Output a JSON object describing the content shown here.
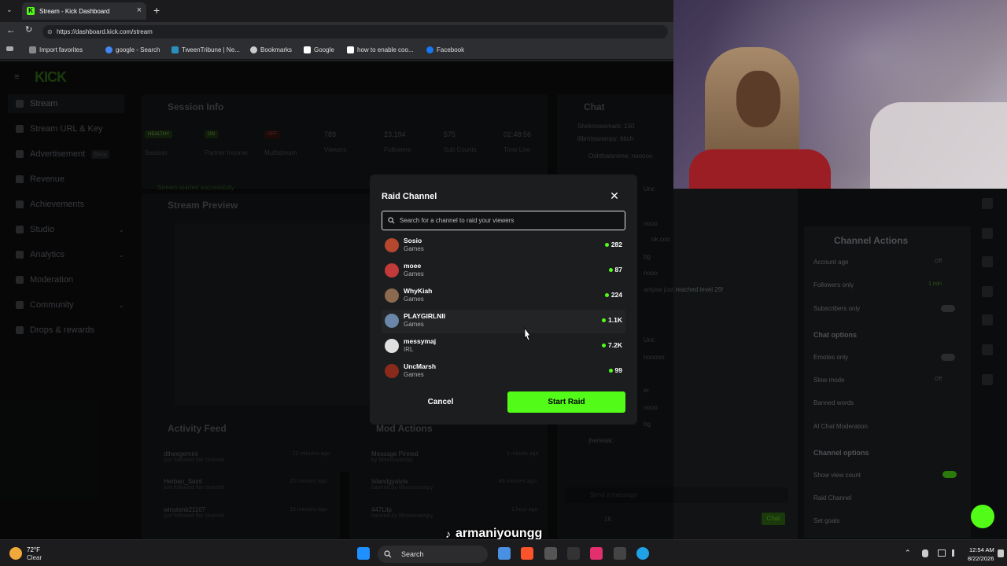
{
  "browser": {
    "tab_title": "Stream - Kick Dashboard",
    "url": "https://dashboard.kick.com/stream",
    "bookmarks": [
      "Import favorites",
      "google - Search",
      "TweenTribune | Ne...",
      "Bookmarks",
      "Google",
      "how to enable coo...",
      "Facebook"
    ]
  },
  "sidebar": {
    "logo": "KICK",
    "items": [
      {
        "label": "Stream"
      },
      {
        "label": "Stream URL & Key"
      },
      {
        "label": "Advertisement",
        "badge": "Beta"
      },
      {
        "label": "Revenue"
      },
      {
        "label": "Achievements"
      },
      {
        "label": "Studio"
      },
      {
        "label": "Analytics"
      },
      {
        "label": "Moderation"
      },
      {
        "label": "Community"
      },
      {
        "label": "Drops & rewards"
      }
    ]
  },
  "session_info": {
    "title": "Session Info",
    "badges": [
      "HEALTHY",
      "ON",
      "OFF"
    ],
    "labels": [
      "Session",
      "Partner Income",
      "Multistream",
      "Viewers",
      "Followers",
      "Sub Counts",
      "Time Live"
    ],
    "values": [
      "789",
      "23,194",
      "575",
      "02:48:56"
    ],
    "notice": "Stream started successfully"
  },
  "stream_preview": {
    "title": "Stream Preview"
  },
  "activity_feed": {
    "title": "Activity Feed",
    "items": [
      {
        "name": "dtheegemini",
        "desc": "just followed the channel",
        "time": "11 minutes ago"
      },
      {
        "name": "Herban_Saint",
        "desc": "just followed the channel",
        "time": "23 minutes ago"
      },
      {
        "name": "winstonb21107",
        "desc": "just followed the channel",
        "time": "33 minutes ago"
      }
    ]
  },
  "mod_actions": {
    "title": "Mod Actions",
    "items": [
      {
        "name": "Message Pinned",
        "desc": "by lilbmissvampy",
        "time": "1 minute ago"
      },
      {
        "name": "Islandgyalvia",
        "desc": "banned by lilbmissvampy",
        "time": "46 minutes ago"
      },
      {
        "name": "447Lilp",
        "desc": "banned by lilbmissvampy",
        "time": "1 hour ago"
      }
    ]
  },
  "chat": {
    "title": "Chat",
    "lines": [
      "Sheknowsmark: 150",
      "lilbmissvampy: bitch",
      "Oohthatsnene: nooooo",
      "Unc",
      "nooo",
      "ok coo",
      "bg",
      "nooo",
      "anlyaa just reached level 29!",
      "Unc",
      "nooooo",
      "er",
      "nooo",
      "bg",
      "jheneaik:"
    ],
    "placeholder": "Send a message",
    "viewer_count": "1K",
    "send_label": "Chat"
  },
  "channel_actions": {
    "title": "Channel Actions",
    "rows": [
      {
        "label": "Account age",
        "value": "Off"
      },
      {
        "label": "Followers only",
        "value": "1 min"
      },
      {
        "label": "Subscribers only",
        "value": ""
      }
    ],
    "chat_options_title": "Chat options",
    "chat_rows": [
      {
        "label": "Emotes only",
        "value": ""
      },
      {
        "label": "Slow mode",
        "value": "Off"
      },
      {
        "label": "Banned words",
        "value": ""
      },
      {
        "label": "AI Chat Moderation",
        "value": ""
      }
    ],
    "channel_options_title": "Channel options",
    "channel_rows": [
      {
        "label": "Show view count",
        "value": ""
      },
      {
        "label": "Raid Channel",
        "value": ""
      },
      {
        "label": "Set goals",
        "value": ""
      }
    ]
  },
  "raid_modal": {
    "title": "Raid Channel",
    "search_placeholder": "Search for a channel to raid your viewers",
    "channels": [
      {
        "name": "Sosio",
        "category": "Games",
        "viewers": "282",
        "avatar_color": "#b5472f"
      },
      {
        "name": "moee",
        "category": "Games",
        "viewers": "87",
        "avatar_color": "#c23a3a"
      },
      {
        "name": "WhyKiah",
        "category": "Games",
        "viewers": "224",
        "avatar_color": "#8b6a50"
      },
      {
        "name": "PLAYGIRLNII",
        "category": "Games",
        "viewers": "1.1K",
        "avatar_color": "#6a86a8"
      },
      {
        "name": "messymaj",
        "category": "IRL",
        "viewers": "7.2K",
        "avatar_color": "#e0e0e0"
      },
      {
        "name": "UncMarsh",
        "category": "Games",
        "viewers": "99",
        "avatar_color": "#8a2a1a"
      }
    ],
    "cancel_label": "Cancel",
    "start_label": "Start Raid"
  },
  "taskbar": {
    "weather_temp": "72°F",
    "weather_desc": "Clear",
    "search_label": "Search",
    "time": "12:54 AM",
    "date": "8/22/2026"
  },
  "watermark": "armaniyoungg",
  "colors": {
    "accent": "#53fc18",
    "modal_bg": "#1b1d1f",
    "page_bg": "#0b0c0d"
  }
}
